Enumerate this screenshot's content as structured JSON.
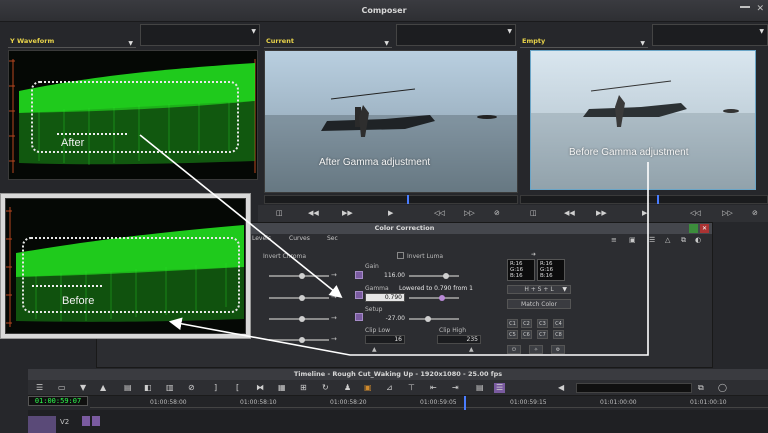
{
  "composer": {
    "title": "Composer",
    "left_source": "Y Waveform",
    "mid_source": "Current",
    "right_source": "Empty"
  },
  "annotations": {
    "after_label": "After",
    "before_label": "Before",
    "after_caption": "After Gamma adjustment",
    "before_caption": "Before Gamma adjustment"
  },
  "color_correction": {
    "title": "Color Correction",
    "tabs": [
      "Levels",
      "Curves",
      "Sec"
    ],
    "invert_chroma": "Invert Chroma",
    "invert_luma": "Invert Luma",
    "gain_label": "Gain",
    "gain_value": "116.00",
    "gamma_label": "Gamma",
    "gamma_value": "0.790",
    "gamma_note": "Lowered to 0.790 from 1",
    "setup_label": "Setup",
    "setup_value": "-27.00",
    "clip_low_label": "Clip Low",
    "clip_low_value": "16",
    "clip_high_label": "Clip High",
    "clip_high_value": "235",
    "rgb_left": "R:16\nG:16\nB:16",
    "rgb_right": "R:16\nG:16\nB:16",
    "mode": "H + S + L",
    "match_color": "Match Color",
    "slots_row1": [
      "C1",
      "C2",
      "C3",
      "C4"
    ],
    "slots_row2": [
      "C5",
      "C6",
      "C7",
      "C8"
    ]
  },
  "timeline": {
    "title": "Timeline - Rough Cut_Waking Up - 1920x1080 - 25.00 fps",
    "timecode": "01:00:59:07",
    "ticks": [
      "01:00:58:00",
      "01:00:58:10",
      "01:00:58:20",
      "01:00:59:05",
      "01:00:59:15",
      "01:01:00:00",
      "01:01:00:10"
    ],
    "track_label": "V2"
  },
  "colors": {
    "waveform": "#22e01f",
    "accent_purple": "#7a5ba0",
    "timecode_green": "#2bff4d",
    "source_yellow": "#e9d44a"
  }
}
